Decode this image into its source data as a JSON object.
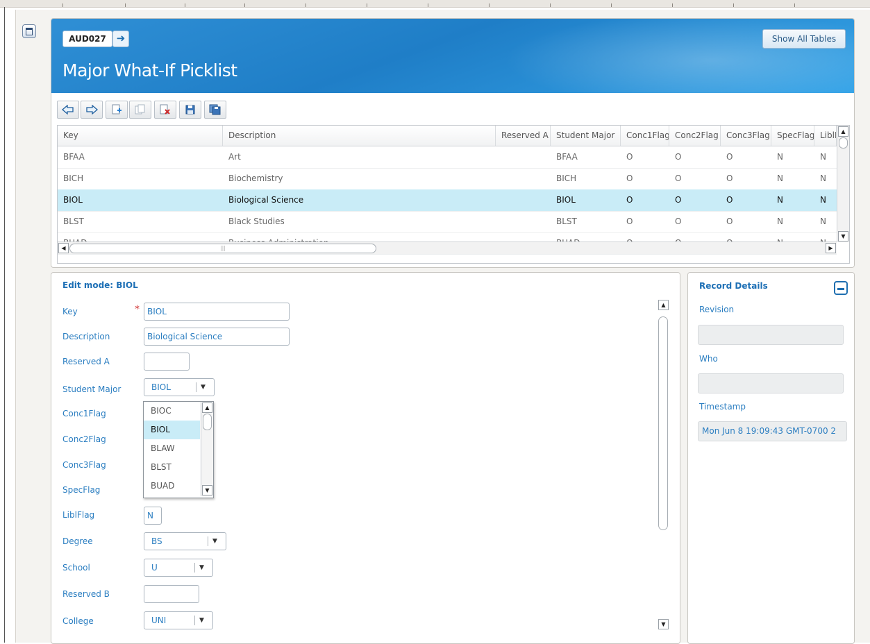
{
  "header": {
    "code": "AUD027",
    "title": "Major What-If Picklist",
    "show_all_label": "Show All Tables"
  },
  "toolbar": {
    "buttons": [
      "prev-arrow-icon",
      "next-arrow-icon",
      "add-record-icon",
      "copy-record-icon",
      "delete-record-icon",
      "save-icon",
      "save-all-icon"
    ]
  },
  "grid": {
    "columns": [
      "Key",
      "Description",
      "Reserved A",
      "Student Major",
      "Conc1Flag",
      "Conc2Flag",
      "Conc3Flag",
      "SpecFlag",
      "LiblFlag"
    ],
    "rows": [
      [
        "BFAA",
        "Art",
        "",
        "BFAA",
        "O",
        "O",
        "O",
        "N",
        "N"
      ],
      [
        "BICH",
        "Biochemistry",
        "",
        "BICH",
        "O",
        "O",
        "O",
        "N",
        "N"
      ],
      [
        "BIOL",
        "Biological Science",
        "",
        "BIOL",
        "O",
        "O",
        "O",
        "N",
        "N"
      ],
      [
        "BLST",
        "Black Studies",
        "",
        "BLST",
        "O",
        "O",
        "O",
        "N",
        "N"
      ],
      [
        "BUAD",
        "Business Administration",
        "",
        "BUAD",
        "O",
        "O",
        "O",
        "N",
        "N"
      ]
    ],
    "selected_row": 2
  },
  "edit": {
    "title": "Edit mode: BIOL",
    "labels": {
      "key": "Key",
      "description": "Description",
      "reserved_a": "Reserved A",
      "student_major": "Student Major",
      "conc1flag": "Conc1Flag",
      "conc2flag": "Conc2Flag",
      "conc3flag": "Conc3Flag",
      "specflag": "SpecFlag",
      "liblflag": "LiblFlag",
      "degree": "Degree",
      "school": "School",
      "reserved_b": "Reserved B",
      "college": "College"
    },
    "values": {
      "key": "BIOL",
      "description": "Biological Science",
      "reserved_a": "",
      "student_major": "BIOL",
      "liblflag": "N",
      "degree": "BS",
      "school": "U",
      "reserved_b": "",
      "college": "UNI"
    },
    "dropdown_options": [
      "BIOC",
      "BIOL",
      "BLAW",
      "BLST",
      "BUAD"
    ],
    "dropdown_selected": "BIOL"
  },
  "details": {
    "title": "Record Details",
    "revision_label": "Revision",
    "revision_value": "",
    "who_label": "Who",
    "who_value": "",
    "timestamp_label": "Timestamp",
    "timestamp_value": "Mon Jun 8 19:09:43 GMT-0700 2"
  },
  "colors": {
    "header_blue": "#1f7ec7",
    "label_blue": "#2b7ec1",
    "selected_row": "#c9ecf7",
    "required_star": "#d23b3b"
  }
}
